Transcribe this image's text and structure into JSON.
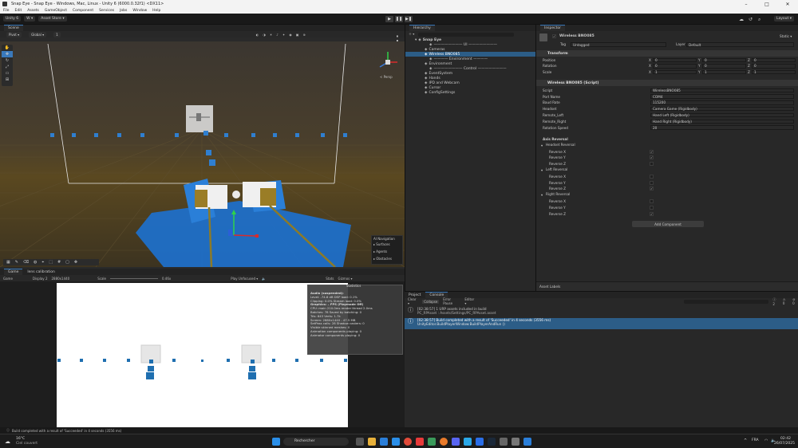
{
  "window": {
    "title": "Snap Eye - Snap Eye - Windows, Mac, Linux - Unity 6 (6000.0.32f1) <DX11>",
    "minimize": "–",
    "maximize": "□",
    "close": "✕"
  },
  "menu": [
    "File",
    "Edit",
    "Assets",
    "GameObject",
    "Component",
    "Services",
    "Jobs",
    "Window",
    "Help"
  ],
  "toolbar": {
    "account": "Unity 6",
    "cloud": "W ▾",
    "store": "Asset Store ▾",
    "layout": "Layout ▾"
  },
  "scene": {
    "tab": "Scene",
    "pivot": "Pivot ▾",
    "global": "Global ▾",
    "grid": "1",
    "persp": "< Persp",
    "overlay": {
      "title": "AI Navigation",
      "items": [
        "Surfaces",
        "Agents",
        "Obstacles"
      ]
    }
  },
  "game": {
    "tab1": "Game",
    "tab2": "lens calibration",
    "mode": "Game",
    "display": "Display 2",
    "res": "2880x1440",
    "scale_label": "Scale",
    "scale": "0.46x",
    "play": "Play Unfocused ▾",
    "stats": "Stats",
    "gizmos": "Gizmos ▾"
  },
  "stats": {
    "title": "Statistics",
    "lines": [
      "Audio (suspended):",
      "Level: -74.8 dB            DSP load: 0.1%",
      "Clipping: 0.0%               Stream load: 0.0%",
      "Graphics:                        – FPS (Playmode Off)",
      "CPU: main 210.0ms  render thread 2.0ms",
      "Batches: 78     Saved by batching: 0",
      "Tris: 643     Verts: 1.7k",
      "Screen: 2880x1440 - 47.5 MB",
      "SetPass calls: 28    Shadow casters: 0",
      "Visible skinned meshes: 0",
      "Animation components playing: 0",
      "Animator components playing: 0"
    ]
  },
  "hierarchy": {
    "tab": "Hierarchy",
    "root": "Snap Eye",
    "items": [
      {
        "label": "———————— UI ————————",
        "indent": 3
      },
      {
        "label": "Cameras",
        "indent": 2
      },
      {
        "label": "Wireless BNO085",
        "indent": 2,
        "selected": true
      },
      {
        "label": "———— Environment ————",
        "indent": 3
      },
      {
        "label": "Environment",
        "indent": 2
      },
      {
        "label": "———————— Control ————————",
        "indent": 3
      },
      {
        "label": "EventSystem",
        "indent": 2
      },
      {
        "label": "Hands",
        "indent": 2
      },
      {
        "label": "IPD and Webcam",
        "indent": 2
      },
      {
        "label": "Cursor",
        "indent": 2
      },
      {
        "label": "ConfigSettings",
        "indent": 2
      }
    ]
  },
  "inspector": {
    "tab": "Inspector",
    "object": "Wireless BNO085",
    "static": "Static ▾",
    "tag_label": "Tag",
    "tag": "Untagged",
    "layer_label": "Layer",
    "layer": "Default",
    "transform": {
      "title": "Transform",
      "rows": [
        {
          "label": "Position",
          "x": "0",
          "y": "0",
          "z": "0"
        },
        {
          "label": "Rotation",
          "x": "0",
          "y": "0",
          "z": "0"
        },
        {
          "label": "Scale",
          "x": "1",
          "y": "1",
          "z": "1"
        }
      ]
    },
    "script": {
      "title": "Wireless BNO085 (Script)",
      "rows": [
        {
          "label": "Script",
          "value": "WirelessBNO085"
        },
        {
          "label": "Port Name",
          "value": "COM4"
        },
        {
          "label": "Baud Rate",
          "value": "115200"
        },
        {
          "label": "Headset",
          "value": "Camera Game (Rigidbody)"
        },
        {
          "label": "Remote_Left",
          "value": "Hand Left (Rigidbody)"
        },
        {
          "label": "Remote_Right",
          "value": "Hand Right (Rigidbody)"
        },
        {
          "label": "Rotation Speed",
          "value": "20"
        }
      ]
    },
    "axis_title": "Axis Reversal",
    "groups": [
      {
        "title": "Headset Reversal",
        "items": [
          {
            "label": "Reverse X",
            "checked": true
          },
          {
            "label": "Reverse Y",
            "checked": true
          },
          {
            "label": "Reverse Z",
            "checked": false
          }
        ]
      },
      {
        "title": "Left Reversal",
        "items": [
          {
            "label": "Reverse X",
            "checked": false
          },
          {
            "label": "Reverse Y",
            "checked": false
          },
          {
            "label": "Reverse Z",
            "checked": true
          }
        ]
      },
      {
        "title": "Right Reversal",
        "items": [
          {
            "label": "Reverse X",
            "checked": false
          },
          {
            "label": "Reverse Y",
            "checked": false
          },
          {
            "label": "Reverse Z",
            "checked": true
          }
        ]
      }
    ],
    "add_component": "Add Component",
    "asset_labels": "Asset Labels"
  },
  "console": {
    "tab_project": "Project",
    "tab_console": "Console",
    "clear": "Clear ▾",
    "collapse": "Collapse",
    "error_pause": "Error Pause",
    "editor": "Editor ▾",
    "counts": {
      "info": "2",
      "warn": "0",
      "error": "0"
    },
    "logs": [
      {
        "l1": "[02:38:57] 1 URP assets included in build",
        "l2": "PC_RPAsset : Assets/Settings/PC_RPAsset.asset",
        "selected": false
      },
      {
        "l1": "[02:38:57] Build completed with a result of 'Succeeded' in 4 seconds (3556 ms)",
        "l2": "UnityEditor.BuildPlayerWindow:BuildPlayerAndRun ()",
        "selected": true
      }
    ]
  },
  "status_bar": "Build completed with a result of 'Succeeded' in 4 seconds (3556 ms)",
  "taskbar": {
    "temp": "16°C",
    "weather": "Ciel couvert",
    "search": "Rechercher",
    "time": "02:42",
    "date": "26/07/2025",
    "lang": "FRA"
  }
}
